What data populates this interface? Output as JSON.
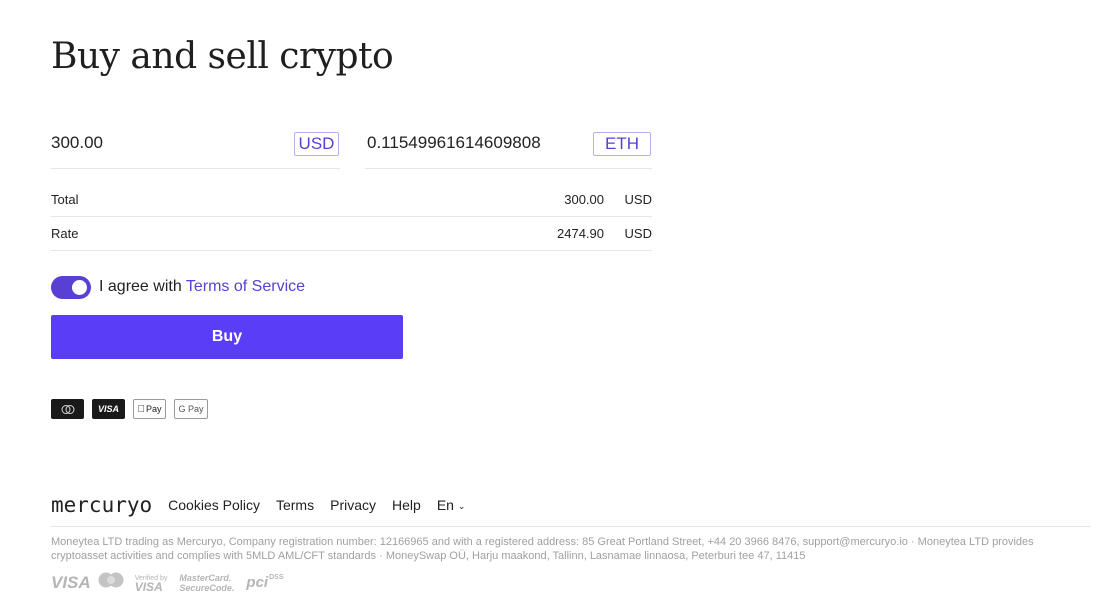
{
  "page": {
    "title": "Buy and sell crypto"
  },
  "exchange": {
    "from_amount": "300.00",
    "from_currency": "USD",
    "to_amount": "0.11549961614609808",
    "to_currency": "ETH"
  },
  "summary": {
    "total_label": "Total",
    "total_value": "300.00",
    "total_currency": "USD",
    "rate_label": "Rate",
    "rate_value": "2474.90",
    "rate_currency": "USD"
  },
  "agreement": {
    "checked": true,
    "text": "I agree with",
    "link_text": "Terms of Service"
  },
  "buy_button": {
    "label": "Buy"
  },
  "payment_methods": [
    {
      "icon": "mastercard-icon"
    },
    {
      "icon": "visa-icon",
      "label": "VISA"
    },
    {
      "icon": "apple-pay-icon",
      "label": "Pay"
    },
    {
      "icon": "google-pay-icon",
      "label": "G Pay"
    }
  ],
  "footer": {
    "logo": "mercuryo",
    "links": [
      "Cookies Policy",
      "Terms",
      "Privacy",
      "Help"
    ],
    "language": "En",
    "legal": "Moneytea LTD trading as Mercuryo, Company registration number: 12166965 and with a registered address: 85 Great Portland Street, +44 20 3966 8476, support@mercuryo.io · Moneytea LTD provides cryptoasset activities and complies with 5MLD AML/CFT standards · MoneySwap OÜ, Harju maakond, Tallinn, Lasnamae linnaosa, Peterburi tee 47, 11415",
    "badges": {
      "visa": "VISA",
      "verified_by": "Verified by",
      "verified_visa": "VISA",
      "mastercard": "MasterCard.",
      "securecode": "SecureCode.",
      "pci": "pci",
      "dss": "DSS"
    }
  },
  "colors": {
    "accent": "#5a3df7",
    "link": "#5a3fd4",
    "border": "#e6e6e6"
  }
}
